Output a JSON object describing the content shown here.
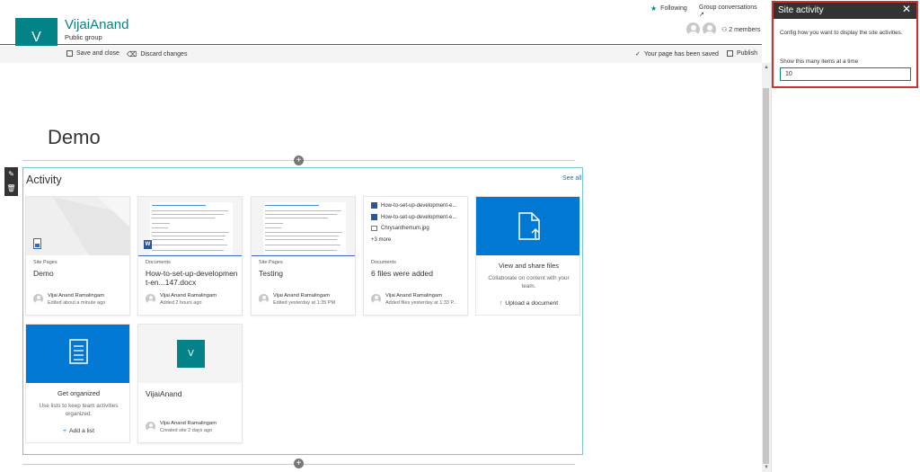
{
  "header": {
    "group_initial": "V",
    "group_name": "VijaiAnand",
    "group_type": "Public group",
    "following": "Following",
    "group_conversations": "Group conversations ↗",
    "members": "2 members"
  },
  "command_bar": {
    "save_close": "Save and close",
    "discard": "Discard changes",
    "saved_status": "Your page has been saved",
    "publish": "Publish"
  },
  "page": {
    "title": "Demo"
  },
  "activity": {
    "title": "Activity",
    "see_all": "See all",
    "cards": [
      {
        "category": "Site Pages",
        "title": "Demo",
        "person": "Vijai Anand Ramalingam",
        "when": "Edited about a minute ago"
      },
      {
        "category": "Documents",
        "title": "How-to-set-up-development-en...147.docx",
        "person": "Vijai Anand Ramalingam",
        "when": "Added 2 hours ago"
      },
      {
        "category": "Site Pages",
        "title": "Testing",
        "person": "Vijai Anand Ramalingam",
        "when": "Edited yesterday at 1:35 PM"
      },
      {
        "category": "Documents",
        "title": "6 files were added",
        "person": "Vijai Anand Ramalingam",
        "when": "Added files yesterday at 1:33 P...",
        "files": [
          "How-to-set-up-development-e...",
          "How-to-set-up-development-e...",
          "Chrysanthemum.jpg"
        ],
        "more": "+3 more"
      }
    ],
    "view_share": {
      "title": "View and share files",
      "desc": "Collaborate on content with your team.",
      "action": "Upload a document"
    },
    "get_organized": {
      "title": "Get organized",
      "desc": "Use lists to keep team activities organized.",
      "action": "Add a list"
    },
    "site_card": {
      "initial": "V",
      "title": "VijaiAnand",
      "person": "Vijai Anand Ramalingam",
      "when": "Created site 2 days ago"
    }
  },
  "pane": {
    "title": "Site activity",
    "description": "Config how you want to display the site activities.",
    "label": "Show this many items at a time",
    "value": "10"
  },
  "colors": {
    "accent": "#038387",
    "blue": "#0078d4",
    "highlight": "#d32f2f"
  }
}
